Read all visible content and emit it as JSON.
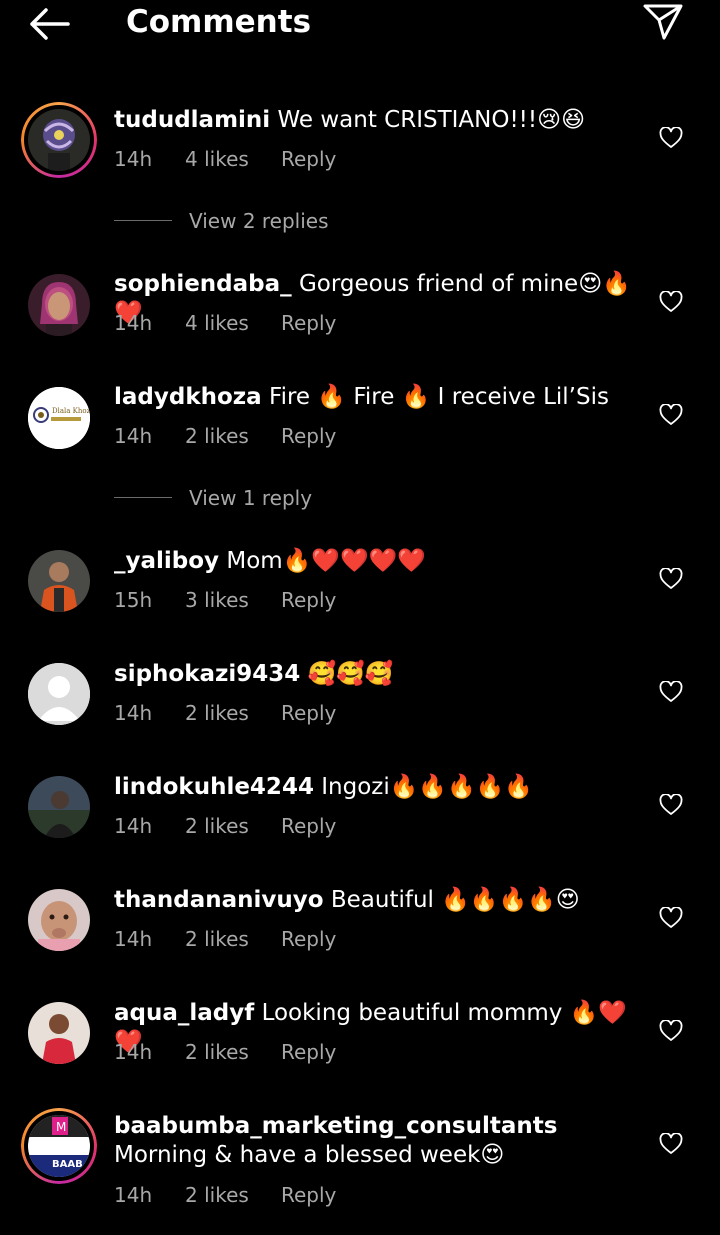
{
  "header": {
    "title": "Comments",
    "back_icon": "arrow-left-icon",
    "send_icon": "paper-plane-icon"
  },
  "comments": [
    {
      "username": "tududlamini",
      "text": "We want CRISTIANO!!!😢😆",
      "time": "14h",
      "likes": "4 likes",
      "reply": "Reply",
      "view_replies": "View 2 replies",
      "has_story_ring": true
    },
    {
      "username": "sophiendaba_",
      "text": "Gorgeous friend of mine😍🔥❤️",
      "time": "14h",
      "likes": "4 likes",
      "reply": "Reply"
    },
    {
      "username": "ladydkhoza",
      "text": "Fire 🔥 Fire 🔥 I receive Lil’Sis",
      "time": "14h",
      "likes": "2 likes",
      "reply": "Reply",
      "view_replies": "View 1 reply"
    },
    {
      "username": "_yaliboy",
      "text": "Mom🔥❤️❤️❤️❤️",
      "time": "15h",
      "likes": "3 likes",
      "reply": "Reply"
    },
    {
      "username": "siphokazi9434",
      "text": "🥰🥰🥰",
      "time": "14h",
      "likes": "2 likes",
      "reply": "Reply"
    },
    {
      "username": "lindokuhle4244",
      "text": "Ingozi🔥🔥🔥🔥🔥",
      "time": "14h",
      "likes": "2 likes",
      "reply": "Reply"
    },
    {
      "username": "thandananivuyo",
      "text": "Beautiful 🔥🔥🔥🔥😍",
      "time": "14h",
      "likes": "2 likes",
      "reply": "Reply"
    },
    {
      "username": "aqua_ladyf",
      "text": "Looking beautiful mommy 🔥❤️❤️",
      "time": "14h",
      "likes": "2 likes",
      "reply": "Reply"
    },
    {
      "username": "baabumba_marketing_consultants",
      "text": "Morning & have a blessed week😍",
      "time": "14h",
      "likes": "2 likes",
      "reply": "Reply",
      "has_story_ring": true
    }
  ],
  "avatar_labels": {
    "ladydkhoza_logo": "Dlala Khoza",
    "baabumba_logo_top": "M",
    "baabumba_logo_bottom": "BAAB"
  },
  "colors": {
    "background": "#000000",
    "text": "#ffffff",
    "secondary_text": "#a8a8a8"
  }
}
